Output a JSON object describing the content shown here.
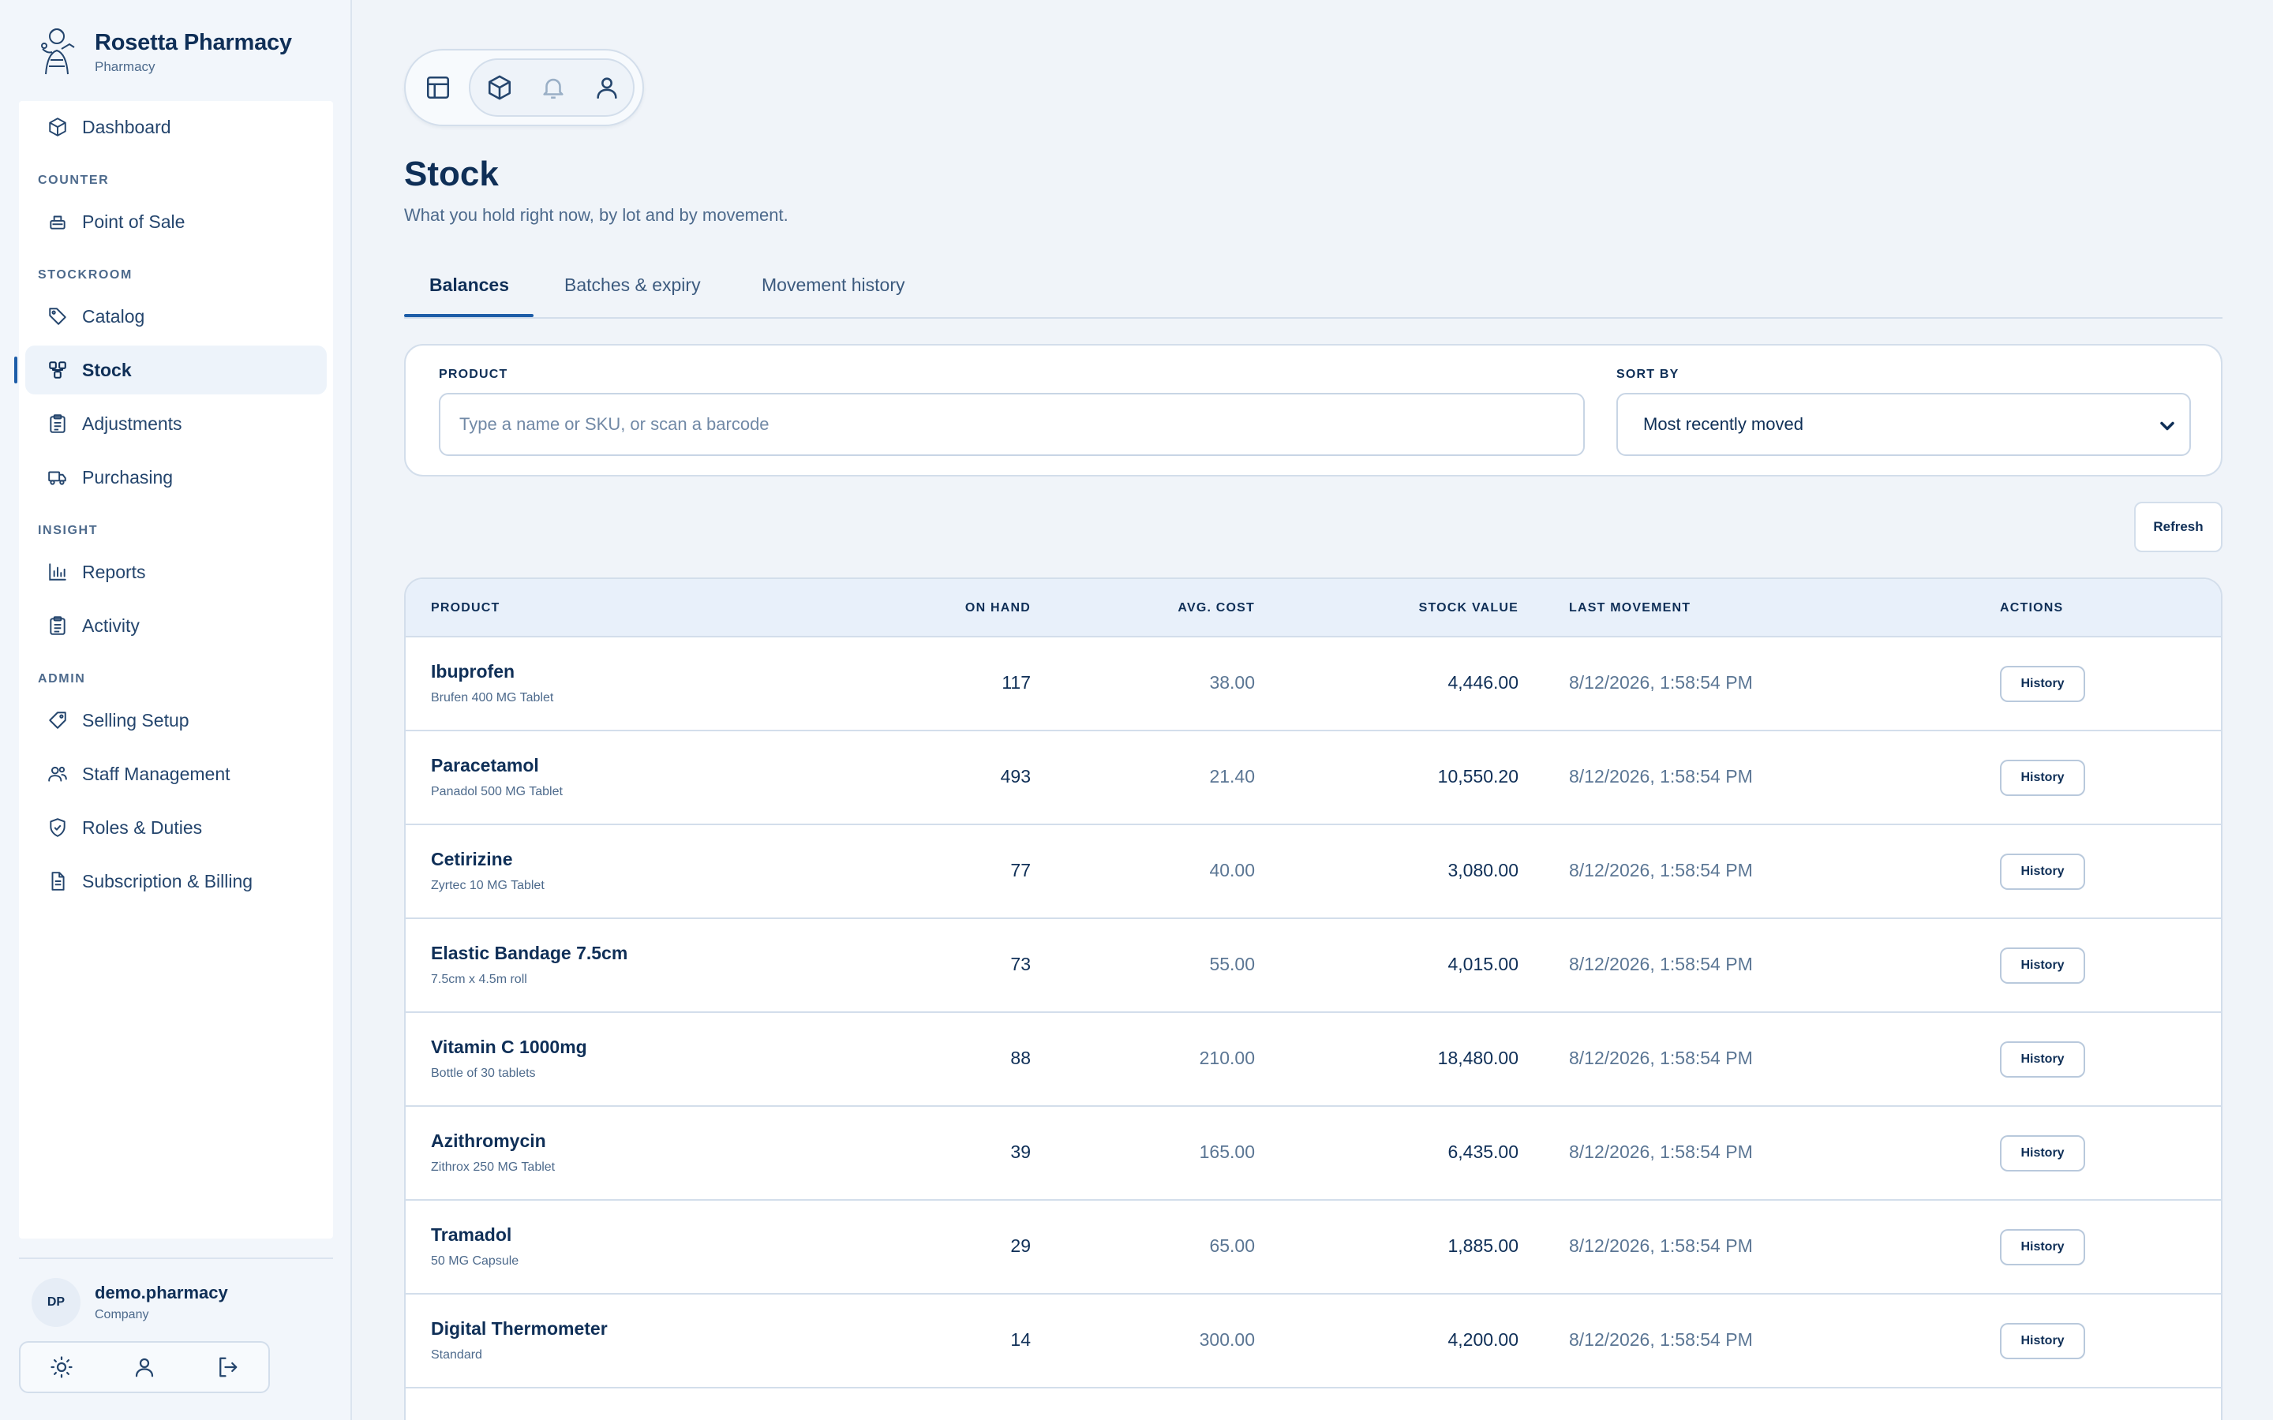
{
  "brand": {
    "name": "Rosetta Pharmacy",
    "subtitle": "Pharmacy",
    "logo_icon": "pharmacist-figure-icon"
  },
  "sidebar": {
    "dashboard": {
      "label": "Dashboard",
      "icon": "cube-icon"
    },
    "sections": {
      "counter": "COUNTER",
      "stockroom": "STOCKROOM",
      "insight": "INSIGHT",
      "admin": "ADMIN"
    },
    "items": {
      "point_of_sale": {
        "label": "Point of Sale",
        "icon": "register-icon"
      },
      "catalog": {
        "label": "Catalog",
        "icon": "tag-icon"
      },
      "stock": {
        "label": "Stock",
        "icon": "stock-nodes-icon",
        "active": true
      },
      "adjustments": {
        "label": "Adjustments",
        "icon": "clipboard-icon"
      },
      "purchasing": {
        "label": "Purchasing",
        "icon": "truck-icon"
      },
      "reports": {
        "label": "Reports",
        "icon": "bar-chart-icon"
      },
      "activity": {
        "label": "Activity",
        "icon": "clipboard-list-icon"
      },
      "selling_setup": {
        "label": "Selling Setup",
        "icon": "price-tag-icon"
      },
      "staff_management": {
        "label": "Staff Management",
        "icon": "users-icon"
      },
      "roles_duties": {
        "label": "Roles & Duties",
        "icon": "shield-check-icon"
      },
      "subscription_billing": {
        "label": "Subscription & Billing",
        "icon": "document-icon"
      }
    },
    "user": {
      "initials": "DP",
      "name": "demo.pharmacy",
      "role": "Company"
    },
    "user_actions": [
      "sun-icon",
      "user-icon",
      "logout-icon"
    ]
  },
  "toolbar": {
    "icons": [
      "layout-icon",
      "cube-icon",
      "bell-icon",
      "user-icon"
    ]
  },
  "page": {
    "title": "Stock",
    "subtitle": "What you hold right now, by lot and by movement."
  },
  "tabs": [
    {
      "label": "Balances",
      "active": true
    },
    {
      "label": "Batches & expiry",
      "active": false
    },
    {
      "label": "Movement history",
      "active": false
    }
  ],
  "filters": {
    "product_label": "PRODUCT",
    "product_placeholder": "Type a name or SKU, or scan a barcode",
    "product_value": "",
    "sort_label": "SORT BY",
    "sort_value": "Most recently moved"
  },
  "refresh_label": "Refresh",
  "table": {
    "headers": {
      "product": "PRODUCT",
      "on_hand": "ON HAND",
      "avg_cost": "AVG. COST",
      "stock_value": "STOCK VALUE",
      "last_movement": "LAST MOVEMENT",
      "actions": "ACTIONS"
    },
    "action_label": "History",
    "rows": [
      {
        "name": "Ibuprofen",
        "desc": "Brufen 400 MG Tablet",
        "on_hand": "117",
        "avg_cost": "38.00",
        "stock_value": "4,446.00",
        "last_movement": "8/12/2026, 1:58:54 PM"
      },
      {
        "name": "Paracetamol",
        "desc": "Panadol 500 MG Tablet",
        "on_hand": "493",
        "avg_cost": "21.40",
        "stock_value": "10,550.20",
        "last_movement": "8/12/2026, 1:58:54 PM"
      },
      {
        "name": "Cetirizine",
        "desc": "Zyrtec 10 MG Tablet",
        "on_hand": "77",
        "avg_cost": "40.00",
        "stock_value": "3,080.00",
        "last_movement": "8/12/2026, 1:58:54 PM"
      },
      {
        "name": "Elastic Bandage 7.5cm",
        "desc": "7.5cm x 4.5m roll",
        "on_hand": "73",
        "avg_cost": "55.00",
        "stock_value": "4,015.00",
        "last_movement": "8/12/2026, 1:58:54 PM"
      },
      {
        "name": "Vitamin C 1000mg",
        "desc": "Bottle of 30 tablets",
        "on_hand": "88",
        "avg_cost": "210.00",
        "stock_value": "18,480.00",
        "last_movement": "8/12/2026, 1:58:54 PM"
      },
      {
        "name": "Azithromycin",
        "desc": "Zithrox 250 MG Tablet",
        "on_hand": "39",
        "avg_cost": "165.00",
        "stock_value": "6,435.00",
        "last_movement": "8/12/2026, 1:58:54 PM"
      },
      {
        "name": "Tramadol",
        "desc": "50 MG Capsule",
        "on_hand": "29",
        "avg_cost": "65.00",
        "stock_value": "1,885.00",
        "last_movement": "8/12/2026, 1:58:54 PM"
      },
      {
        "name": "Digital Thermometer",
        "desc": "Standard",
        "on_hand": "14",
        "avg_cost": "300.00",
        "stock_value": "4,200.00",
        "last_movement": "8/12/2026, 1:58:54 PM"
      }
    ]
  },
  "colors": {
    "primary": "#0f2f57",
    "accent": "#1d5da8",
    "muted": "#4d6a8c",
    "border": "#d3deeb",
    "header_bg": "#e8f0fa",
    "page_bg": "#f0f4f9"
  }
}
